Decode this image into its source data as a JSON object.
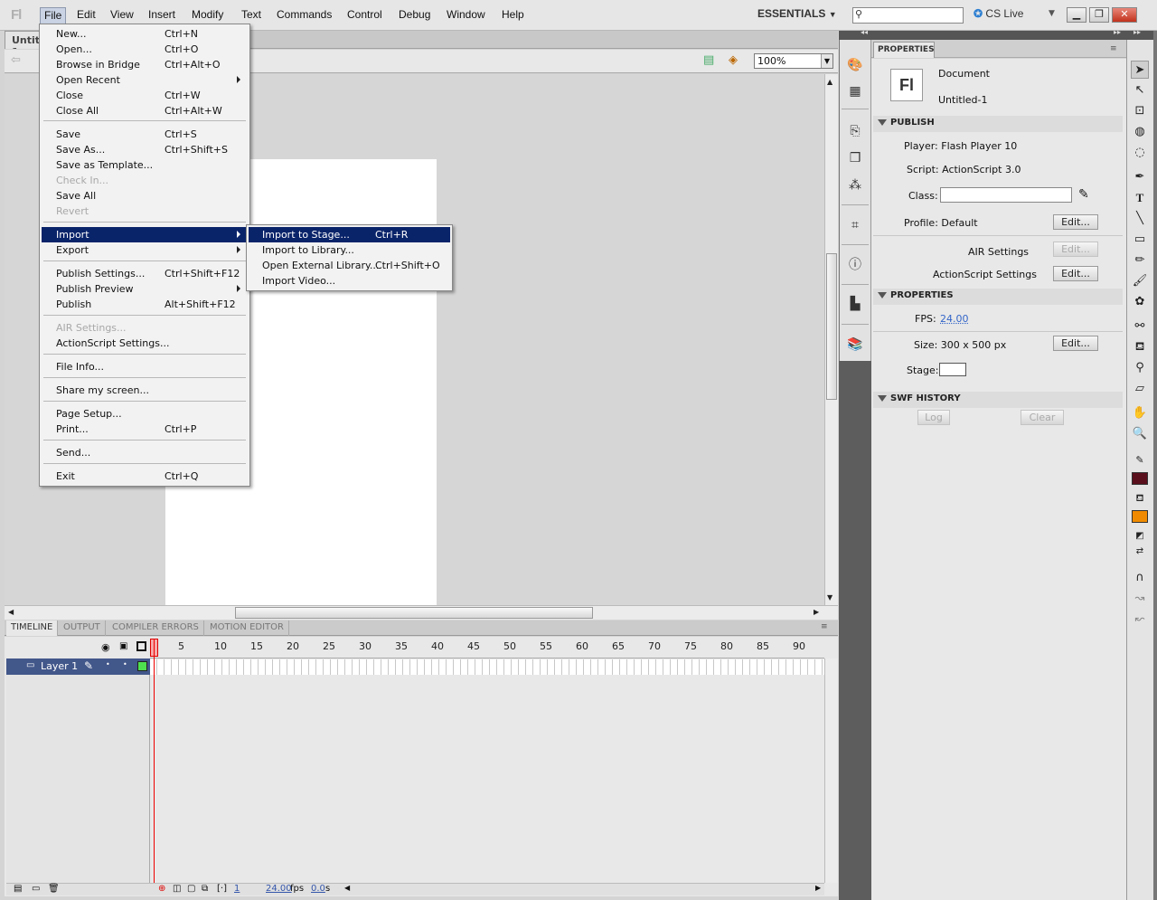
{
  "app": {
    "logo": "Fl"
  },
  "menubar": {
    "items": [
      "File",
      "Edit",
      "View",
      "Insert",
      "Modify",
      "Text",
      "Commands",
      "Control",
      "Debug",
      "Window",
      "Help"
    ]
  },
  "workspace": {
    "label": "ESSENTIALS",
    "search_placeholder": "",
    "cslive": "CS Live"
  },
  "document": {
    "tab_title": "Untitled-1",
    "zoom": "100%"
  },
  "file_menu": {
    "items": [
      {
        "label": "New...",
        "shortcut": "Ctrl+N"
      },
      {
        "label": "Open...",
        "shortcut": "Ctrl+O"
      },
      {
        "label": "Browse in Bridge",
        "shortcut": "Ctrl+Alt+O"
      },
      {
        "label": "Open Recent",
        "shortcut": ""
      },
      {
        "label": "Close",
        "shortcut": "Ctrl+W"
      },
      {
        "label": "Close All",
        "shortcut": "Ctrl+Alt+W"
      },
      {
        "label": "Save",
        "shortcut": "Ctrl+S"
      },
      {
        "label": "Save As...",
        "shortcut": "Ctrl+Shift+S"
      },
      {
        "label": "Save as Template...",
        "shortcut": ""
      },
      {
        "label": "Check In...",
        "shortcut": ""
      },
      {
        "label": "Save All",
        "shortcut": ""
      },
      {
        "label": "Revert",
        "shortcut": ""
      },
      {
        "label": "Import",
        "shortcut": ""
      },
      {
        "label": "Export",
        "shortcut": ""
      },
      {
        "label": "Publish Settings...",
        "shortcut": "Ctrl+Shift+F12"
      },
      {
        "label": "Publish Preview",
        "shortcut": ""
      },
      {
        "label": "Publish",
        "shortcut": "Alt+Shift+F12"
      },
      {
        "label": "AIR Settings...",
        "shortcut": ""
      },
      {
        "label": "ActionScript Settings...",
        "shortcut": ""
      },
      {
        "label": "File Info...",
        "shortcut": ""
      },
      {
        "label": "Share my screen...",
        "shortcut": ""
      },
      {
        "label": "Page Setup...",
        "shortcut": ""
      },
      {
        "label": "Print...",
        "shortcut": "Ctrl+P"
      },
      {
        "label": "Send...",
        "shortcut": ""
      },
      {
        "label": "Exit",
        "shortcut": "Ctrl+Q"
      }
    ]
  },
  "import_submenu": {
    "items": [
      {
        "label": "Import to Stage...",
        "shortcut": "Ctrl+R"
      },
      {
        "label": "Import to Library...",
        "shortcut": ""
      },
      {
        "label": "Open External Library...",
        "shortcut": "Ctrl+Shift+O"
      },
      {
        "label": "Import Video...",
        "shortcut": ""
      }
    ]
  },
  "timeline": {
    "tabs": [
      "TIMELINE",
      "OUTPUT",
      "COMPILER ERRORS",
      "MOTION EDITOR"
    ],
    "layer_name": "Layer 1",
    "ruler": [
      "1",
      "5",
      "10",
      "15",
      "20",
      "25",
      "30",
      "35",
      "40",
      "45",
      "50",
      "55",
      "60",
      "65",
      "70",
      "75",
      "80",
      "85",
      "90"
    ],
    "current_frame": "1",
    "fps": "24.00",
    "fps_unit": "fps",
    "elapsed": "0.0",
    "elapsed_unit": "s"
  },
  "properties": {
    "tab": "PROPERTIES",
    "doc_type": "Document",
    "doc_name": "Untitled-1",
    "fl_icon": "Fl",
    "publish_section": "PUBLISH",
    "player": "Player: Flash Player 10",
    "script": "Script: ActionScript 3.0",
    "class_label": "Class:",
    "class_value": "",
    "profile": "Profile: Default",
    "edit": "Edit...",
    "air_settings": "AIR Settings",
    "as_settings": "ActionScript Settings",
    "props_section": "PROPERTIES",
    "fps_label": "FPS:",
    "fps_value": "24.00",
    "size": "Size: 300 x 500 px",
    "stage_label": "Stage:",
    "swf_section": "SWF HISTORY",
    "log": "Log",
    "clear": "Clear"
  },
  "colors": {
    "stroke": "#5a0f1c",
    "fill": "#f08a00",
    "menu_highlight": "#0a246a"
  }
}
